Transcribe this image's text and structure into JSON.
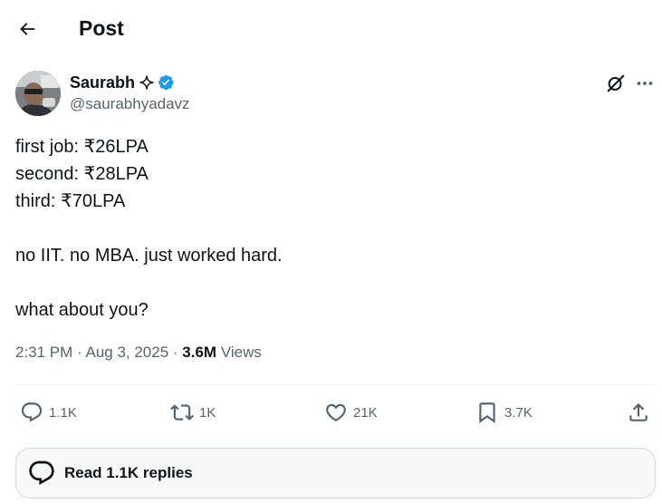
{
  "header": {
    "back_icon": "arrow-left-icon",
    "title": "Post"
  },
  "author": {
    "display_name": "Saurabh",
    "badge_icons": [
      "spark-icon",
      "verified-icon"
    ],
    "handle": "@saurabhyadavz",
    "verified_color": "#1d9bf0"
  },
  "tweet": {
    "lines": [
      "first job: ₹26LPA",
      "second: ₹28LPA",
      "third: ₹70LPA",
      "",
      "no IIT. no MBA. just worked hard.",
      "",
      "what about you?"
    ]
  },
  "meta": {
    "time": "2:31 PM",
    "separator": " · ",
    "date": "Aug 3, 2025",
    "views_count": "3.6M",
    "views_label": " Views"
  },
  "actions": {
    "reply": {
      "icon": "reply-icon",
      "count": "1.1K"
    },
    "repost": {
      "icon": "repost-icon",
      "count": "1K"
    },
    "like": {
      "icon": "heart-icon",
      "count": "21K"
    },
    "bookmark": {
      "icon": "bookmark-icon",
      "count": "3.7K"
    },
    "share": {
      "icon": "share-icon"
    }
  },
  "replies": {
    "label": "Read 1.1K replies"
  },
  "colors": {
    "text": "#0f1419",
    "secondary": "#536471",
    "divider": "#eff3f4",
    "accent": "#1d9bf0"
  }
}
